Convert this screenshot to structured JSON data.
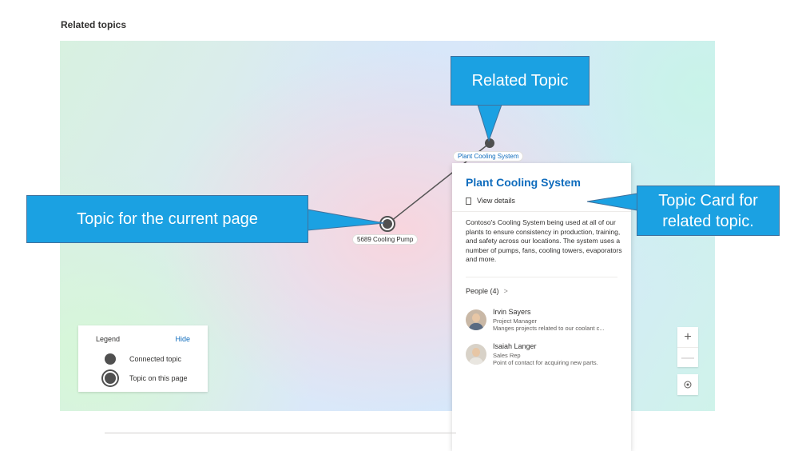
{
  "section": {
    "title": "Related topics"
  },
  "graph": {
    "current_topic": "5689 Cooling Pump",
    "related_topic": "Plant Cooling System"
  },
  "legend": {
    "title": "Legend",
    "hide_label": "Hide",
    "items": [
      {
        "label": "Connected topic",
        "icon": "connected-topic-dot"
      },
      {
        "label": "Topic on this page",
        "icon": "current-topic-ring"
      }
    ]
  },
  "zoom": {
    "in_label": "+",
    "out_label": "—",
    "recenter_icon": "recenter-icon"
  },
  "card": {
    "title": "Plant Cooling System",
    "view_details": "View details",
    "description": "Contoso's Cooling System being used at all of our plants to ensure consistency in production, training, and safety across our locations. The system uses a number of pumps, fans, cooling towers, evaporators and more.",
    "people_header": "People (4)",
    "people": [
      {
        "name": "Irvin Sayers",
        "role": "Project Manager",
        "desc": "Manges projects related to our coolant c..."
      },
      {
        "name": "Isaiah Langer",
        "role": "Sales Rep",
        "desc": "Point of contact for acquiring new parts."
      }
    ]
  },
  "callouts": {
    "related": "Related Topic",
    "current": "Topic for the current page",
    "card_line1": "Topic Card for",
    "card_line2": "related topic."
  },
  "colors": {
    "accent": "#0f6cbd",
    "callout": "#1ba1e2",
    "node": "#505050"
  }
}
